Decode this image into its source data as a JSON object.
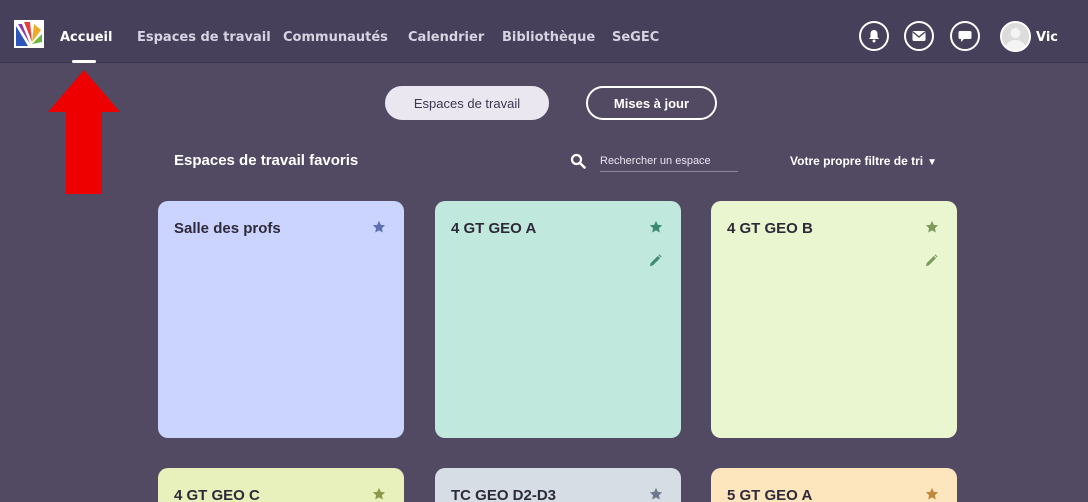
{
  "nav": {
    "items": [
      {
        "label": "Accueil",
        "active": true
      },
      {
        "label": "Espaces de travail"
      },
      {
        "label": "Communautés"
      },
      {
        "label": "Calendrier"
      },
      {
        "label": "Bibliothèque"
      },
      {
        "label": "SeGEC"
      }
    ],
    "icons": [
      "bell-icon",
      "envelope-icon",
      "chat-icon"
    ],
    "user_name": "Vic"
  },
  "toggle": {
    "workspaces_label": "Espaces de travail",
    "updates_label": "Mises à jour",
    "selected": "workspaces"
  },
  "favorites": {
    "title": "Espaces de travail favoris",
    "search_placeholder": "Rechercher un espace",
    "sort_label": "Votre propre filtre de tri"
  },
  "cards": [
    {
      "title": "Salle des profs",
      "color": "#cad4ff",
      "star_color": "#5d6fb0",
      "editable": false
    },
    {
      "title": "4 GT GEO A",
      "color": "#c0e8dc",
      "star_color": "#3e8a70",
      "editable": true
    },
    {
      "title": "4 GT GEO B",
      "color": "#e9f6cf",
      "star_color": "#7d9a5a",
      "editable": true
    },
    {
      "title": "4 GT GEO C",
      "color": "#e8f0bc",
      "star_color": "#8a9a4a",
      "editable": false
    },
    {
      "title": "TC GEO D2-D3",
      "color": "#d6dde4",
      "star_color": "#6a7a8a",
      "editable": false
    },
    {
      "title": "5 GT GEO A",
      "color": "#fde6bd",
      "star_color": "#c08a3a",
      "editable": false
    }
  ],
  "colors": {
    "background": "#524a62",
    "navbar": "#46405a",
    "annotation_arrow": "#ee0000"
  }
}
